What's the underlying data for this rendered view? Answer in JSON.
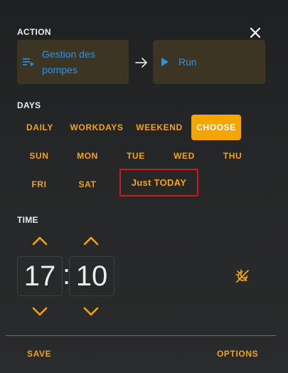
{
  "action": {
    "label": "ACTION",
    "entity": {
      "line1": "Gestion des",
      "line2": "pompes",
      "icon": "playlist-icon"
    },
    "service": {
      "label": "Run",
      "icon": "play-icon"
    }
  },
  "days": {
    "label": "DAYS",
    "modes": [
      "DAILY",
      "WORKDAYS",
      "WEEKEND",
      "CHOOSE"
    ],
    "selected_mode": "CHOOSE",
    "weekdays_row1": [
      "SUN",
      "MON",
      "TUE",
      "WED",
      "THU"
    ],
    "weekdays_row2": [
      "FRI",
      "SAT"
    ],
    "today": "Just TODAY"
  },
  "time": {
    "label": "TIME",
    "hours": "17",
    "separator": ":",
    "minutes": "10",
    "sun_icon": "sun-moon-icon"
  },
  "footer": {
    "save": "SAVE",
    "options": "OPTIONS"
  },
  "colors": {
    "accent": "#f5a500",
    "link": "#2a93e4",
    "card": "#3d3524",
    "highlight_border": "#d2181b"
  }
}
